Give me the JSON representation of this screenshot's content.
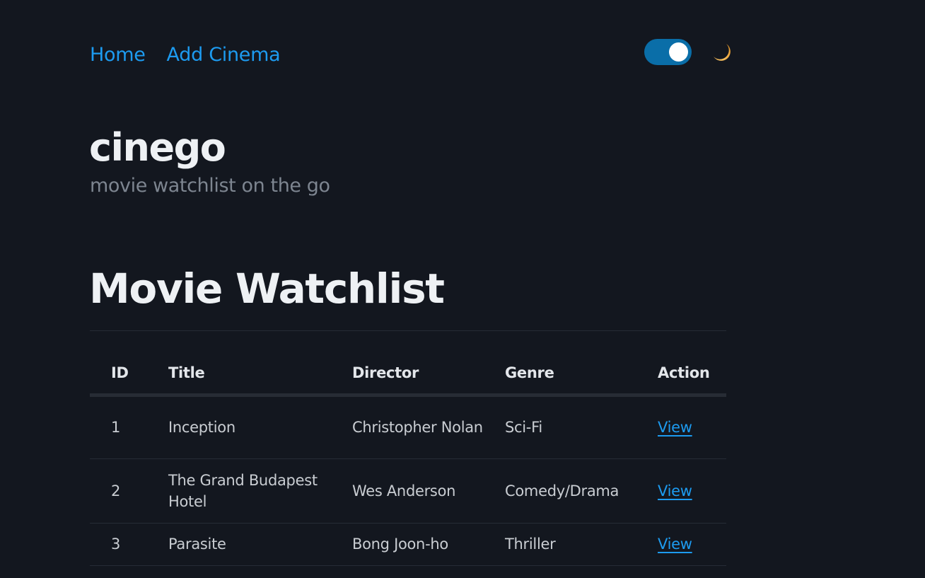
{
  "nav": {
    "home": "Home",
    "add_cinema": "Add Cinema"
  },
  "theme": {
    "dark_mode": true,
    "toggle_color": "#0a6ea8",
    "moon_icon": "crescent-moon-icon"
  },
  "brand": {
    "name": "cinego",
    "tagline": "movie watchlist on the go"
  },
  "watchlist": {
    "heading": "Movie Watchlist",
    "columns": [
      "ID",
      "Title",
      "Director",
      "Genre",
      "Action"
    ],
    "rows": [
      {
        "id": "1",
        "title": "Inception",
        "director": "Christopher Nolan",
        "genre": "Sci-Fi",
        "action": "View"
      },
      {
        "id": "2",
        "title": "The Grand Budapest Hotel",
        "director": "Wes Anderson",
        "genre": "Comedy/Drama",
        "action": "View"
      },
      {
        "id": "3",
        "title": "Parasite",
        "director": "Bong Joon-ho",
        "genre": "Thriller",
        "action": "View"
      }
    ]
  },
  "colors": {
    "background": "#13171f",
    "link": "#1d9bf0",
    "muted": "#7d8590"
  }
}
